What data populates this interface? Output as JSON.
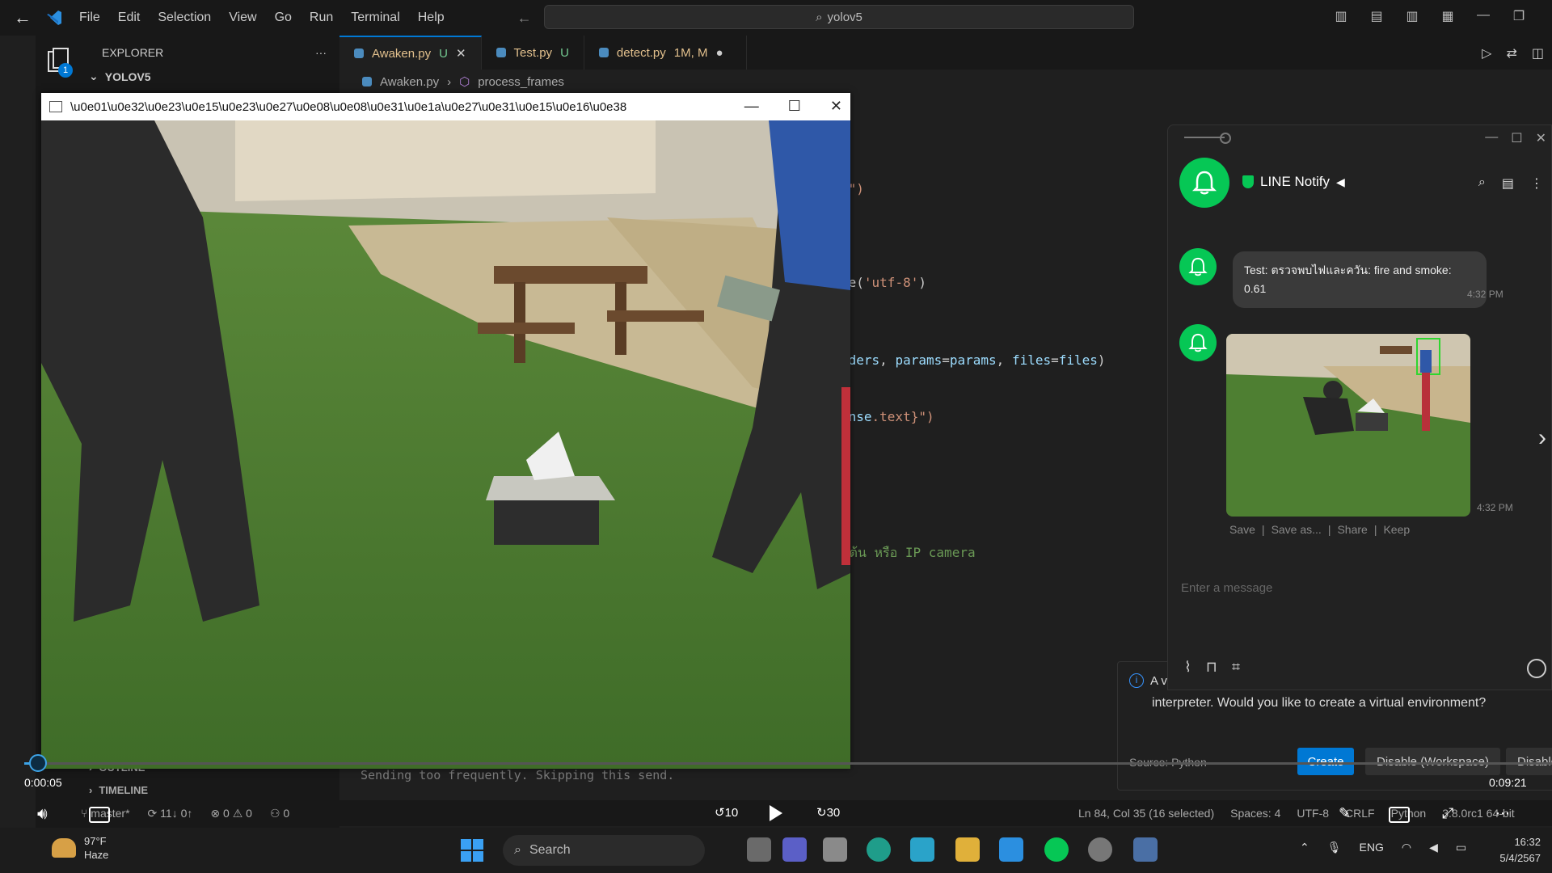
{
  "menu": {
    "file": "File",
    "edit": "Edit",
    "selection": "Selection",
    "view": "View",
    "go": "Go",
    "run": "Run",
    "terminal": "Terminal",
    "help": "Help"
  },
  "command_center": "yolov5",
  "sidebar": {
    "title": "EXPLORER",
    "more": "···",
    "project": "YOLOV5",
    "outline": "OUTLINE",
    "timeline": "TIMELINE"
  },
  "tabs": [
    {
      "label": "Awaken.py",
      "status": "U"
    },
    {
      "label": "Test.py",
      "status": "U"
    },
    {
      "label": "detect.py",
      "status": "1M, M"
    }
  ],
  "breadcrumb": {
    "file": "Awaken.py",
    "symbol": "process_frames"
  },
  "code_fragments": {
    "l1": ".\")",
    "l2a": "de(",
    "l2b": "'utf-8'",
    "l2c": ")",
    "l3a": "aders",
    "l3b": ", ",
    "l3c": "params",
    "l3d": "=",
    "l3e": "params",
    "l3f": ", ",
    "l3g": "files",
    "l3h": "=",
    "l3i": "files",
    "l3j": ")",
    "l4a": "onse",
    "l4b": ".text}\")",
    "l5": "มต้น หรือ IP camera"
  },
  "terminal_message": "Sending too frequently. Skipping this send.",
  "statusbar": {
    "branch": "master*",
    "sync": "11↓ 0↑",
    "errors": "0",
    "warnings": "0",
    "ports": "0",
    "cursor": "Ln 84, Col 35 (16 selected)",
    "spaces": "Spaces: 4",
    "encoding": "UTF-8",
    "eol": "CRLF",
    "language": "Python",
    "interpreter": "3.8.0rc1 64-bit"
  },
  "notification": {
    "head": "A v",
    "text": "interpreter. Would you like to create a virtual environment?",
    "source": "Source: Python",
    "create": "Create",
    "disable_workspace": "Disable (Workspace)",
    "disable": "Disable"
  },
  "cv_window": {
    "title": "\\u0e01\\u0e32\\u0e23\\u0e15\\u0e23\\u0e27\\u0e08\\u0e08\\u0e31\\u0e1a\\u0e27\\u0e31\\u0e15\\u0e16\\u0e38"
  },
  "line": {
    "name": "LINE Notify",
    "message": "Test: ตรวจพบไฟและควัน: fire and smoke: 0.61",
    "time1": "4:32 PM",
    "time2": "4:32 PM",
    "actions": [
      "Save",
      "Save as...",
      "Share",
      "Keep"
    ],
    "input_placeholder": "Enter a message"
  },
  "player": {
    "current_time": "0:00:05",
    "total_time": "0:09:21",
    "progress": 0.009,
    "rewind": "10",
    "forward": "30"
  },
  "taskbar": {
    "temperature": "97°F",
    "weather": "Haze",
    "search": "Search",
    "lang": "ENG",
    "time": "16:32",
    "date": "5/4/2567"
  },
  "colors": {
    "accent": "#0078d4",
    "line_green": "#06c755",
    "seek": "#3da3e6"
  }
}
